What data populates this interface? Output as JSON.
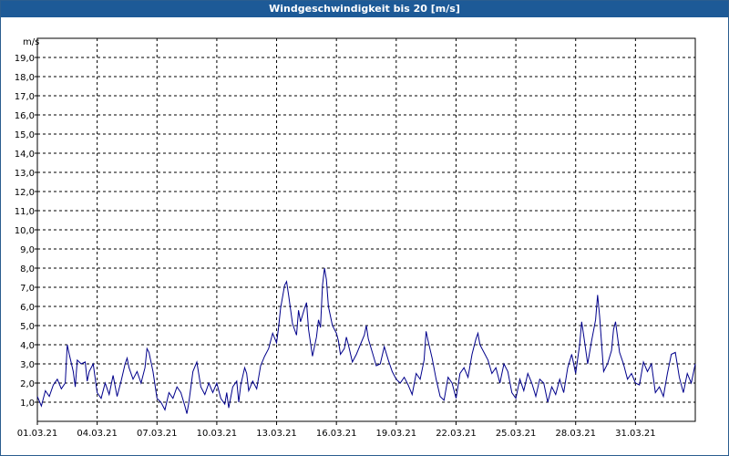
{
  "window": {
    "title": "Windgeschwindigkeit bis 20 [m/s]"
  },
  "chart_data": {
    "type": "line",
    "title": "Windgeschwindigkeit bis 20 [m/s]",
    "ylabel": "m/s",
    "xlabel": "",
    "ylim": [
      0,
      20
    ],
    "xlim_days": [
      0,
      33
    ],
    "y_ticks": [
      "1,0",
      "2,0",
      "3,0",
      "4,0",
      "5,0",
      "6,0",
      "7,0",
      "8,0",
      "9,0",
      "10,0",
      "11,0",
      "12,0",
      "13,0",
      "14,0",
      "15,0",
      "16,0",
      "17,0",
      "18,0",
      "19,0"
    ],
    "x_ticks": [
      "01.03.21",
      "04.03.21",
      "07.03.21",
      "10.03.21",
      "13.03.21",
      "16.03.21",
      "19.03.21",
      "22.03.21",
      "25.03.21",
      "28.03.21",
      "31.03.21"
    ],
    "grid": true,
    "line_color": "#00008b",
    "series": [
      {
        "values": [
          [
            0.0,
            1.3
          ],
          [
            0.2,
            0.8
          ],
          [
            0.4,
            1.6
          ],
          [
            0.6,
            1.3
          ],
          [
            0.8,
            1.9
          ],
          [
            1.0,
            2.2
          ],
          [
            1.2,
            1.7
          ],
          [
            1.4,
            2.0
          ],
          [
            1.5,
            4.0
          ],
          [
            1.6,
            3.5
          ],
          [
            1.8,
            2.6
          ],
          [
            1.9,
            1.8
          ],
          [
            2.0,
            3.2
          ],
          [
            2.2,
            3.0
          ],
          [
            2.4,
            3.1
          ],
          [
            2.5,
            2.1
          ],
          [
            2.6,
            2.6
          ],
          [
            2.8,
            3.0
          ],
          [
            3.0,
            1.5
          ],
          [
            3.2,
            1.2
          ],
          [
            3.4,
            2.0
          ],
          [
            3.6,
            1.4
          ],
          [
            3.8,
            2.4
          ],
          [
            4.0,
            1.3
          ],
          [
            4.2,
            2.1
          ],
          [
            4.4,
            3.0
          ],
          [
            4.5,
            3.3
          ],
          [
            4.6,
            2.8
          ],
          [
            4.8,
            2.2
          ],
          [
            5.0,
            2.6
          ],
          [
            5.2,
            2.0
          ],
          [
            5.4,
            2.8
          ],
          [
            5.5,
            3.8
          ],
          [
            5.6,
            3.6
          ],
          [
            5.8,
            2.6
          ],
          [
            6.0,
            1.2
          ],
          [
            6.2,
            1.0
          ],
          [
            6.4,
            0.6
          ],
          [
            6.6,
            1.5
          ],
          [
            6.8,
            1.2
          ],
          [
            7.0,
            1.8
          ],
          [
            7.2,
            1.5
          ],
          [
            7.4,
            0.8
          ],
          [
            7.5,
            0.4
          ],
          [
            7.6,
            1.0
          ],
          [
            7.8,
            2.6
          ],
          [
            8.0,
            3.1
          ],
          [
            8.2,
            1.8
          ],
          [
            8.4,
            1.4
          ],
          [
            8.6,
            2.0
          ],
          [
            8.8,
            1.5
          ],
          [
            9.0,
            2.0
          ],
          [
            9.2,
            1.2
          ],
          [
            9.4,
            0.9
          ],
          [
            9.5,
            1.5
          ],
          [
            9.6,
            0.7
          ],
          [
            9.8,
            1.8
          ],
          [
            10.0,
            2.1
          ],
          [
            10.1,
            1.0
          ],
          [
            10.2,
            1.9
          ],
          [
            10.4,
            2.8
          ],
          [
            10.5,
            2.5
          ],
          [
            10.6,
            1.6
          ],
          [
            10.8,
            2.1
          ],
          [
            11.0,
            1.7
          ],
          [
            11.2,
            2.9
          ],
          [
            11.4,
            3.4
          ],
          [
            11.6,
            3.8
          ],
          [
            11.8,
            4.6
          ],
          [
            12.0,
            4.1
          ],
          [
            12.1,
            4.9
          ],
          [
            12.2,
            5.9
          ],
          [
            12.4,
            7.1
          ],
          [
            12.5,
            7.3
          ],
          [
            12.6,
            6.6
          ],
          [
            12.8,
            5.1
          ],
          [
            13.0,
            4.5
          ],
          [
            13.1,
            5.8
          ],
          [
            13.2,
            5.2
          ],
          [
            13.4,
            5.9
          ],
          [
            13.5,
            6.2
          ],
          [
            13.6,
            4.8
          ],
          [
            13.8,
            3.4
          ],
          [
            14.0,
            4.4
          ],
          [
            14.1,
            5.3
          ],
          [
            14.2,
            4.9
          ],
          [
            14.3,
            7.1
          ],
          [
            14.4,
            8.0
          ],
          [
            14.5,
            7.4
          ],
          [
            14.6,
            6.0
          ],
          [
            14.8,
            5.0
          ],
          [
            15.0,
            4.6
          ],
          [
            15.1,
            4.2
          ],
          [
            15.2,
            3.5
          ],
          [
            15.4,
            3.8
          ],
          [
            15.5,
            4.4
          ],
          [
            15.6,
            4.0
          ],
          [
            15.8,
            3.1
          ],
          [
            16.0,
            3.5
          ],
          [
            16.2,
            4.0
          ],
          [
            16.4,
            4.5
          ],
          [
            16.5,
            5.0
          ],
          [
            16.6,
            4.3
          ],
          [
            16.8,
            3.6
          ],
          [
            17.0,
            2.9
          ],
          [
            17.2,
            3.0
          ],
          [
            17.4,
            3.9
          ],
          [
            17.6,
            3.2
          ],
          [
            17.8,
            2.6
          ],
          [
            18.0,
            2.2
          ],
          [
            18.2,
            2.0
          ],
          [
            18.4,
            2.3
          ],
          [
            18.6,
            1.9
          ],
          [
            18.8,
            1.4
          ],
          [
            19.0,
            2.5
          ],
          [
            19.2,
            2.2
          ],
          [
            19.4,
            3.2
          ],
          [
            19.5,
            4.7
          ],
          [
            19.6,
            4.2
          ],
          [
            19.8,
            3.3
          ],
          [
            20.0,
            2.2
          ],
          [
            20.2,
            1.3
          ],
          [
            20.4,
            1.1
          ],
          [
            20.6,
            2.3
          ],
          [
            20.8,
            2.0
          ],
          [
            21.0,
            1.2
          ],
          [
            21.2,
            2.5
          ],
          [
            21.4,
            2.8
          ],
          [
            21.6,
            2.3
          ],
          [
            21.8,
            3.5
          ],
          [
            22.0,
            4.3
          ],
          [
            22.1,
            4.6
          ],
          [
            22.2,
            4.0
          ],
          [
            22.4,
            3.6
          ],
          [
            22.6,
            3.2
          ],
          [
            22.8,
            2.5
          ],
          [
            23.0,
            2.8
          ],
          [
            23.2,
            2.0
          ],
          [
            23.4,
            3.0
          ],
          [
            23.6,
            2.6
          ],
          [
            23.8,
            1.5
          ],
          [
            24.0,
            1.2
          ],
          [
            24.2,
            2.2
          ],
          [
            24.4,
            1.6
          ],
          [
            24.6,
            2.5
          ],
          [
            24.8,
            2.0
          ],
          [
            25.0,
            1.3
          ],
          [
            25.2,
            2.2
          ],
          [
            25.4,
            2.0
          ],
          [
            25.6,
            1.0
          ],
          [
            25.8,
            1.8
          ],
          [
            26.0,
            1.4
          ],
          [
            26.2,
            2.2
          ],
          [
            26.4,
            1.5
          ],
          [
            26.6,
            2.8
          ],
          [
            26.8,
            3.5
          ],
          [
            27.0,
            2.5
          ],
          [
            27.2,
            4.0
          ],
          [
            27.3,
            5.2
          ],
          [
            27.4,
            4.5
          ],
          [
            27.6,
            3.0
          ],
          [
            27.8,
            4.2
          ],
          [
            28.0,
            5.3
          ],
          [
            28.1,
            6.6
          ],
          [
            28.2,
            5.5
          ],
          [
            28.4,
            2.6
          ],
          [
            28.6,
            3.0
          ],
          [
            28.8,
            3.7
          ],
          [
            28.9,
            4.8
          ],
          [
            29.0,
            5.2
          ],
          [
            29.2,
            3.6
          ],
          [
            29.4,
            3.0
          ],
          [
            29.6,
            2.2
          ],
          [
            29.8,
            2.5
          ],
          [
            30.0,
            2.0
          ],
          [
            30.2,
            1.9
          ],
          [
            30.4,
            3.1
          ],
          [
            30.6,
            2.6
          ],
          [
            30.8,
            3.0
          ],
          [
            31.0,
            1.5
          ],
          [
            31.2,
            1.8
          ],
          [
            31.4,
            1.3
          ],
          [
            31.6,
            2.5
          ],
          [
            31.8,
            3.5
          ],
          [
            32.0,
            3.6
          ],
          [
            32.2,
            2.3
          ],
          [
            32.4,
            1.5
          ],
          [
            32.6,
            2.5
          ],
          [
            32.8,
            2.0
          ],
          [
            33.0,
            3.0
          ]
        ]
      }
    ]
  }
}
